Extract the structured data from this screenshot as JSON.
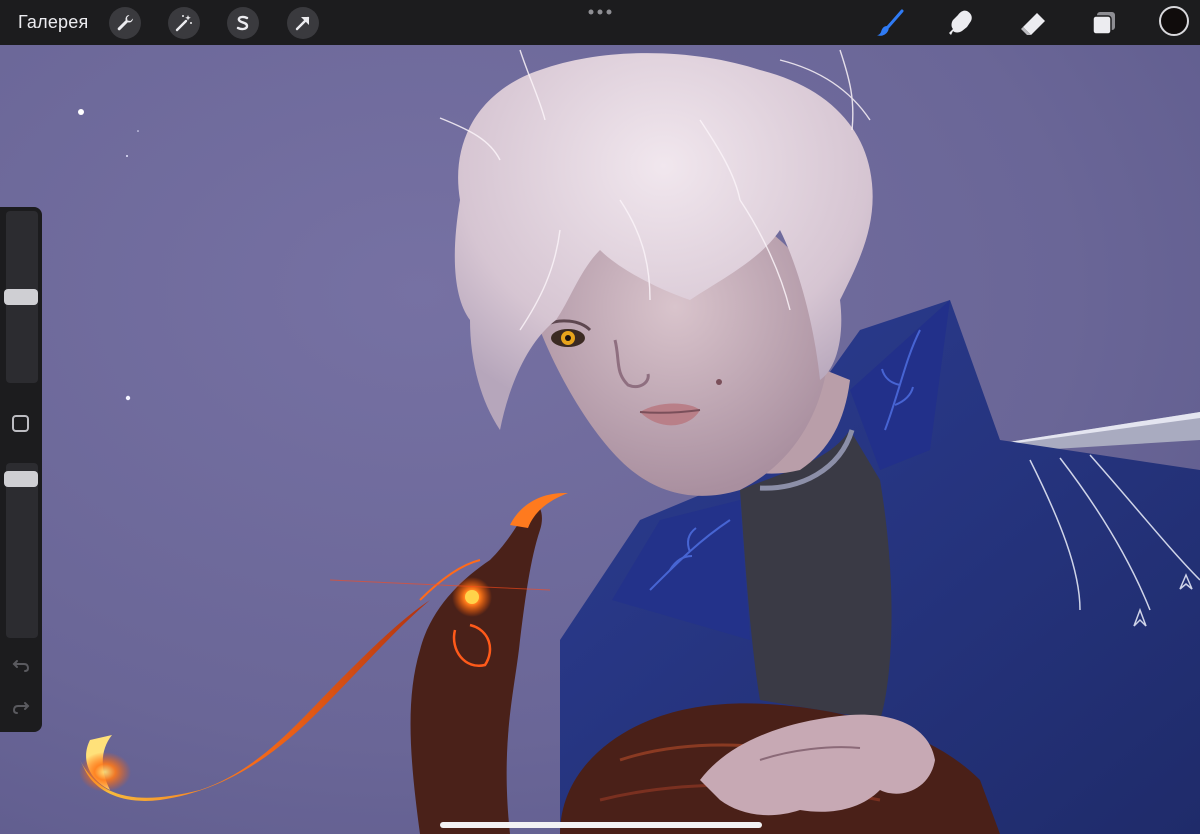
{
  "toolbar": {
    "gallery_label": "Галерея",
    "left_tools": [
      {
        "name": "actions",
        "icon": "wrench-icon"
      },
      {
        "name": "adjustments",
        "icon": "magic-wand-icon"
      },
      {
        "name": "selection",
        "icon": "selection-s-icon"
      },
      {
        "name": "transform",
        "icon": "arrow-cursor-icon"
      }
    ],
    "center_more": "more-dots-icon",
    "right_tools": [
      {
        "name": "brush",
        "icon": "brush-icon",
        "active": true,
        "color": "#2f7bf5"
      },
      {
        "name": "smudge",
        "icon": "smudge-icon"
      },
      {
        "name": "eraser",
        "icon": "eraser-icon"
      },
      {
        "name": "layers",
        "icon": "layers-icon"
      }
    ],
    "current_color": "#100c0c"
  },
  "sidebar": {
    "brush_size_level": 0.5,
    "opacity_level": 0.95,
    "modify_button": "square-icon",
    "undo": "undo-icon",
    "redo": "redo-icon"
  },
  "canvas": {
    "background_color": "#6f6b99"
  }
}
